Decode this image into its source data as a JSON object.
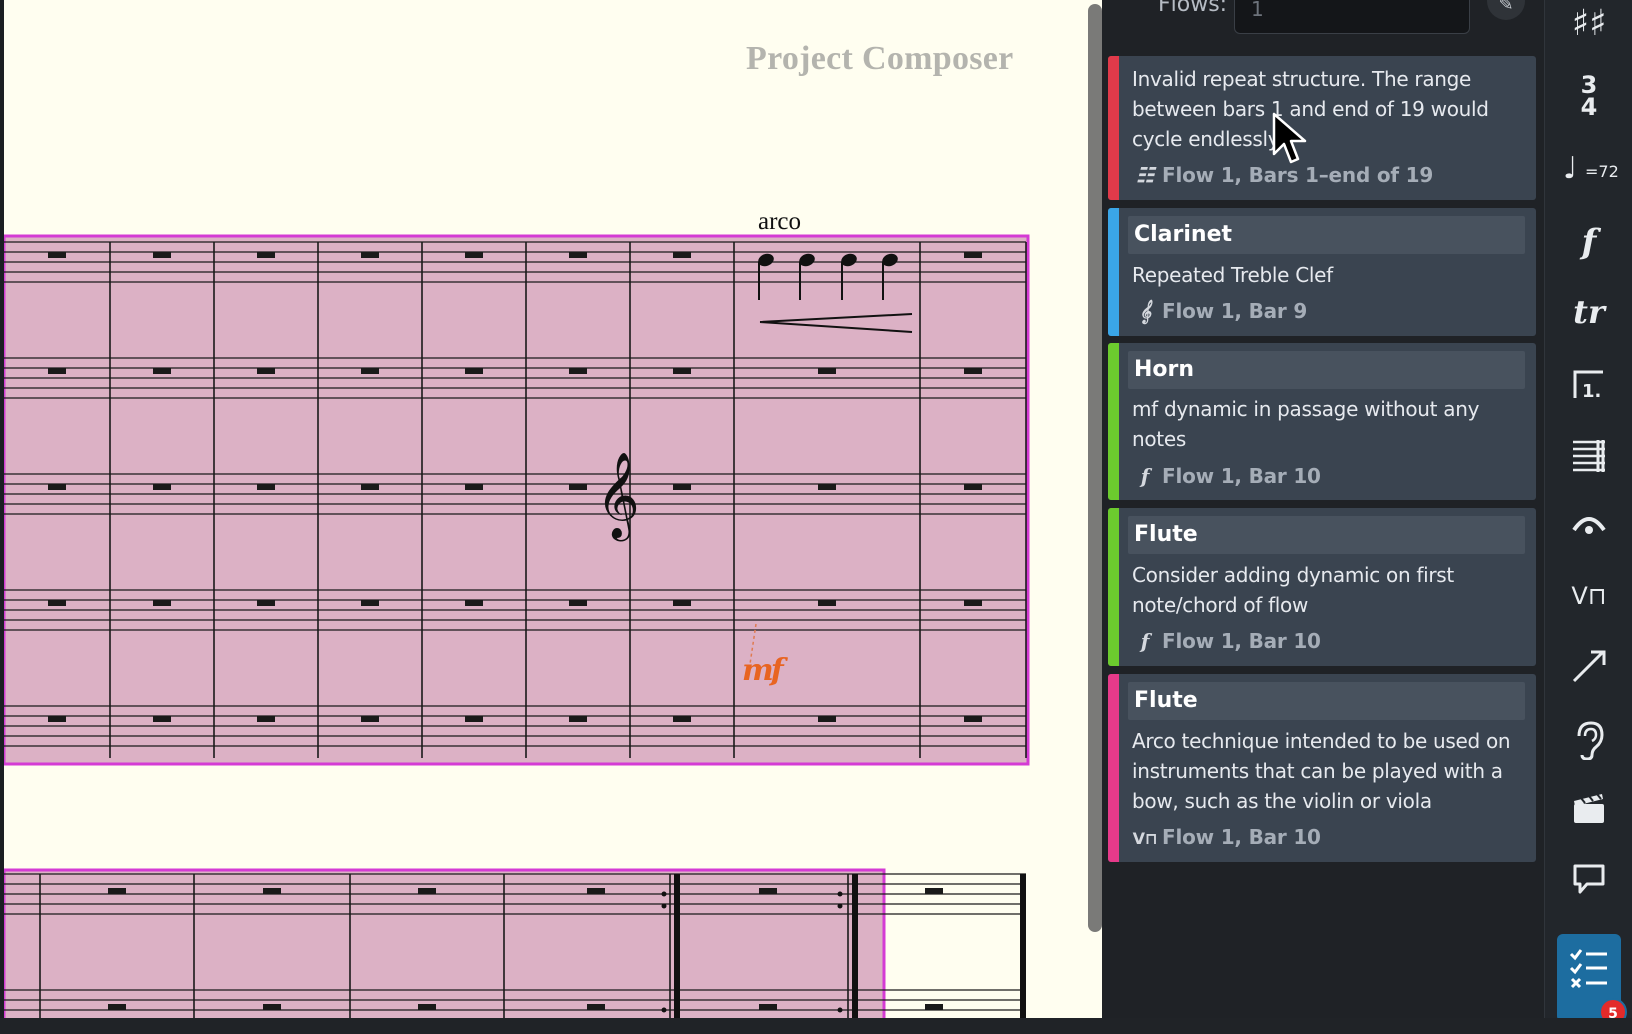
{
  "score": {
    "composer": "Project Composer",
    "arco_text": "arco",
    "dynamic_text": "mf"
  },
  "flows": {
    "label": "Flows:",
    "value": "1"
  },
  "problems": [
    {
      "title": "",
      "message": "Invalid repeat structure. The range between bars 1 and end of 19 would cycle endlessly",
      "location": "Flow 1, Bars 1–end of 19",
      "location_icon": "repeat-bar-icon",
      "color": "#e03a4a"
    },
    {
      "title": "Clarinet",
      "message": "Repeated Treble Clef",
      "location": "Flow 1, Bar 9",
      "location_icon": "treble-clef-icon",
      "color": "#3aa6e8"
    },
    {
      "title": "Horn",
      "message": "mf dynamic in passage without any notes",
      "location": "Flow 1, Bar 10",
      "location_icon": "dynamic-f-icon",
      "color": "#6ccb2e"
    },
    {
      "title": "Flute",
      "message": "Consider adding dynamic on first note/chord of flow",
      "location": "Flow 1, Bar 10",
      "location_icon": "dynamic-f-icon",
      "color": "#6ccb2e"
    },
    {
      "title": "Flute",
      "message": "Arco technique intended to be used on instruments that can be played with a bow, such as the violin or viola",
      "location": "Flow 1, Bar 10",
      "location_icon": "bowing-icon",
      "color": "#e63a8a"
    }
  ],
  "toolbar": {
    "items": [
      {
        "name": "key-signatures-icon"
      },
      {
        "name": "time-signatures-icon",
        "numerator": "3",
        "denominator": "4"
      },
      {
        "name": "tempo-icon",
        "text": "=72"
      },
      {
        "name": "dynamics-icon",
        "text": "f"
      },
      {
        "name": "trill-ornaments-icon",
        "text": "tr"
      },
      {
        "name": "repeat-endings-icon"
      },
      {
        "name": "repeat-structures-icon"
      },
      {
        "name": "holds-pauses-icon"
      },
      {
        "name": "playing-techniques-icon"
      },
      {
        "name": "lines-icon"
      },
      {
        "name": "audio-listen-icon"
      },
      {
        "name": "video-clapper-icon"
      },
      {
        "name": "comments-icon"
      },
      {
        "name": "problems-checklist-icon",
        "badge": "5"
      }
    ]
  },
  "colors": {
    "selection_fill": "#dcb1c5",
    "selection_border": "#d43bd4",
    "page_background": "#fffef0",
    "panel_background": "#1f2226",
    "card_background": "#3a4450",
    "accent": "#1d6da0",
    "badge": "#e32a2a"
  }
}
